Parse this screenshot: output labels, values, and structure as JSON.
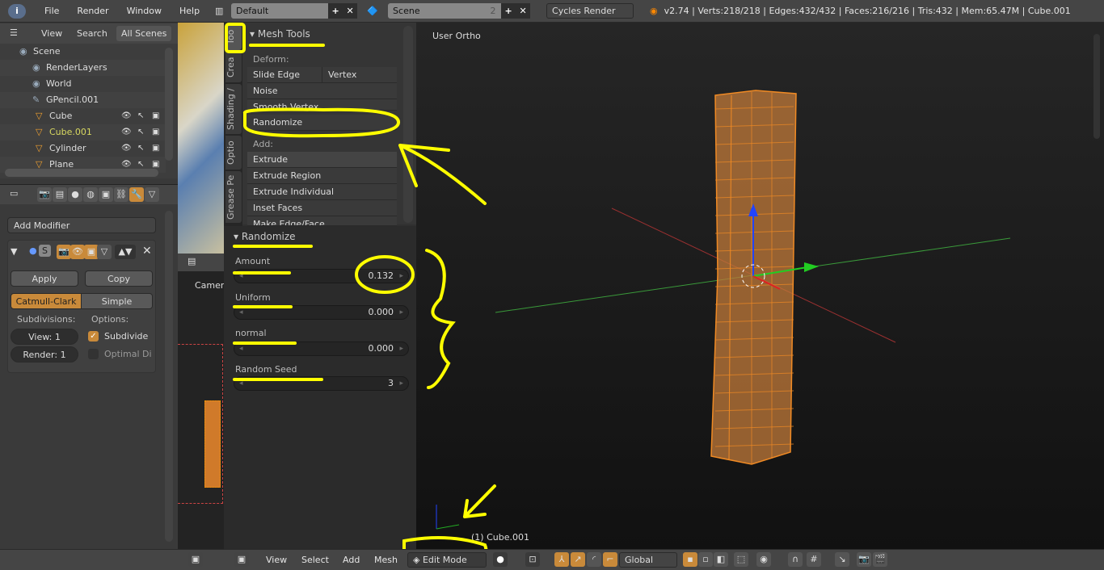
{
  "topbar": {
    "menus": [
      "File",
      "Render",
      "Window",
      "Help"
    ],
    "screen": "Default",
    "scene": "Scene",
    "scene_users": "2",
    "engine": "Cycles Render",
    "stats": "v2.74 | Verts:218/218 | Edges:432/432 | Faces:216/216 | Tris:432 | Mem:65.47M | Cube.001"
  },
  "outliner": {
    "menus": [
      "View",
      "Search"
    ],
    "filter": "All Scenes",
    "items": [
      {
        "label": "Scene",
        "icon": "scene-icon"
      },
      {
        "label": "RenderLayers",
        "icon": "renderlayers-icon"
      },
      {
        "label": "World",
        "icon": "world-icon"
      },
      {
        "label": "GPencil.001",
        "icon": "pencil-icon"
      },
      {
        "label": "Cube",
        "icon": "mesh-icon"
      },
      {
        "label": "Cube.001",
        "icon": "mesh-icon",
        "active": true
      },
      {
        "label": "Cylinder",
        "icon": "mesh-icon"
      },
      {
        "label": "Plane",
        "icon": "mesh-icon"
      }
    ]
  },
  "properties": {
    "add_modifier": "Add Modifier",
    "modifier_name": "S",
    "apply": "Apply",
    "copy": "Copy",
    "catmull": "Catmull-Clark",
    "simple": "Simple",
    "subdivisions": "Subdivisions:",
    "options": "Options:",
    "view_label": "View:",
    "view_val": "1",
    "render_label": "Render:",
    "render_val": "1",
    "subdivide": "Subdivide",
    "subdivide_checked": true,
    "optimal": "Optimal Di",
    "optimal_checked": false
  },
  "middle": {
    "camera_label": "Camera"
  },
  "shelf": {
    "tabs": [
      "Too",
      "Crea",
      "Shading /",
      "Optio",
      "Grease Pe"
    ],
    "panel_title": "Mesh Tools",
    "deform_label": "Deform:",
    "slide_edge": "Slide Edge",
    "vertex": "Vertex",
    "noise": "Noise",
    "smooth_vertex": "Smooth Vertex",
    "randomize": "Randomize",
    "add_label": "Add:",
    "extrude": "Extrude",
    "extrude_region": "Extrude Region",
    "extrude_individual": "Extrude Individual",
    "inset_faces": "Inset Faces",
    "make_edge_face": "Make Edge/Face"
  },
  "operator": {
    "title": "Randomize",
    "fields": [
      {
        "label": "Amount",
        "value": "0.132"
      },
      {
        "label": "Uniform",
        "value": "0.000"
      },
      {
        "label": "normal",
        "value": "0.000"
      },
      {
        "label": "Random Seed",
        "value": "3"
      }
    ]
  },
  "viewport": {
    "view_name": "User Ortho",
    "object_label": "(1) Cube.001"
  },
  "bottombar": {
    "menus": [
      "View",
      "Select",
      "Add",
      "Mesh"
    ],
    "mode": "Edit Mode",
    "orientation": "Global"
  },
  "colors": {
    "accent": "#c98a3a",
    "mesh": "#f08a24",
    "annotation": "#ffff00"
  }
}
